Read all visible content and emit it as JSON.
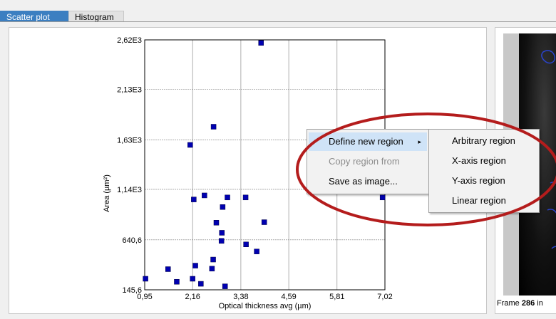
{
  "tabs": [
    {
      "label": "Scatter plot",
      "active": true
    },
    {
      "label": "Histogram",
      "active": false
    }
  ],
  "chart_data": {
    "type": "scatter",
    "xlabel": "Optical thickness avg (µm)",
    "ylabel": "Area (µm²)",
    "xlim": [
      0.95,
      7.02
    ],
    "ylim": [
      145.6,
      2620
    ],
    "x_ticks": [
      0.95,
      2.16,
      3.38,
      4.59,
      5.81,
      7.02
    ],
    "x_tick_labels": [
      "0,95",
      "2,16",
      "3,38",
      "4,59",
      "5,81",
      "7,02"
    ],
    "y_ticks": [
      145.6,
      640.6,
      1140,
      1630,
      2130,
      2620
    ],
    "y_tick_labels": [
      "145,6",
      "640,6",
      "1,14E3",
      "1,63E3",
      "2,13E3",
      "2,62E3"
    ],
    "grid": true,
    "marker_color": "#0000b0",
    "points": [
      {
        "x": 3.89,
        "y": 2590
      },
      {
        "x": 2.69,
        "y": 1760
      },
      {
        "x": 2.1,
        "y": 1580
      },
      {
        "x": 2.46,
        "y": 1080
      },
      {
        "x": 2.19,
        "y": 1040
      },
      {
        "x": 3.04,
        "y": 1060
      },
      {
        "x": 3.5,
        "y": 1060
      },
      {
        "x": 2.92,
        "y": 965
      },
      {
        "x": 2.76,
        "y": 810
      },
      {
        "x": 3.97,
        "y": 815
      },
      {
        "x": 2.9,
        "y": 710
      },
      {
        "x": 2.89,
        "y": 630
      },
      {
        "x": 3.51,
        "y": 595
      },
      {
        "x": 3.78,
        "y": 525
      },
      {
        "x": 2.68,
        "y": 445
      },
      {
        "x": 2.23,
        "y": 385
      },
      {
        "x": 2.65,
        "y": 355
      },
      {
        "x": 1.54,
        "y": 350
      },
      {
        "x": 2.16,
        "y": 255
      },
      {
        "x": 0.97,
        "y": 255
      },
      {
        "x": 1.76,
        "y": 225
      },
      {
        "x": 2.37,
        "y": 205
      },
      {
        "x": 2.98,
        "y": 180
      },
      {
        "x": 6.96,
        "y": 1060
      }
    ]
  },
  "context_menu": {
    "items": [
      {
        "label": "Define new region",
        "enabled": true,
        "has_submenu": true,
        "highlighted": true
      },
      {
        "label": "Copy region from",
        "enabled": false,
        "has_submenu": false,
        "highlighted": false
      },
      {
        "label": "Save as image...",
        "enabled": true,
        "has_submenu": false,
        "highlighted": false
      }
    ],
    "submenu_arrow": "▸"
  },
  "submenu": {
    "items": [
      {
        "label": "Arbitrary region"
      },
      {
        "label": "X-axis region"
      },
      {
        "label": "Y-axis region"
      },
      {
        "label": "Linear region"
      }
    ]
  },
  "frame_info": {
    "prefix": "Frame",
    "number": "286",
    "suffix": "in"
  },
  "annotation": {
    "color": "#b41c1c",
    "icon": "highlight-ellipse"
  }
}
